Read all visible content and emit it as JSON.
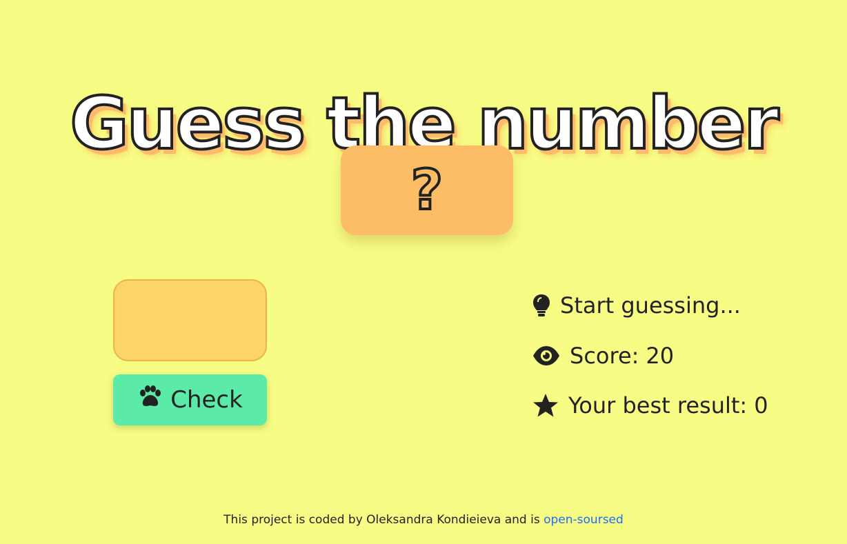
{
  "app": {
    "title": "Guess the number"
  },
  "secret": {
    "display": "?"
  },
  "input": {
    "value": "",
    "placeholder": ""
  },
  "check_button": {
    "label": "Check",
    "icon": "paw-icon",
    "color": "#5ceaa8"
  },
  "status": {
    "hint_icon": "lightbulb-icon",
    "hint": "Start guessing...",
    "score_icon": "eye-icon",
    "score_label": "Score:",
    "score_value": "20",
    "best_icon": "star-icon",
    "best_label": "Your best result:",
    "best_value": "0"
  },
  "footer": {
    "text": "This project is coded by Oleksandra Kondieieva and is ",
    "link_text": "open-soursed",
    "link_color": "#1b6ef3"
  },
  "colors": {
    "background": "#f7fd84",
    "secret_box": "#fdbd66",
    "input_bg": "#fdd46a",
    "title_shadow": "#fdbb6b"
  }
}
